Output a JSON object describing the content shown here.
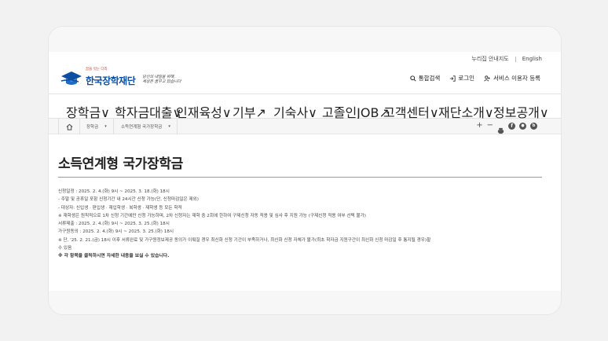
{
  "utility": {
    "sitemap": "누리집 안내지도",
    "english": "English"
  },
  "logo": {
    "small": "꿈을 잇는 다리",
    "name": "한국장학재단",
    "slogan_line1": "당신의 내일을 위해,",
    "slogan_line2": "세상은 꿈꾸고 있습니다"
  },
  "header_links": {
    "search": "통합검색",
    "login": "로그인",
    "signup": "서비스 이용자 등록"
  },
  "gnb": [
    {
      "label": "장학금",
      "mark": "∨"
    },
    {
      "label": "학자금대출",
      "mark": "∨"
    },
    {
      "label": "인재육성",
      "mark": "∨"
    },
    {
      "label": "기부",
      "mark": "↗"
    },
    {
      "label": "기숙사",
      "mark": "∨"
    },
    {
      "label": "고졸인JOB",
      "mark": "↗"
    },
    {
      "label": "고객센터",
      "mark": "∨"
    },
    {
      "label": "재단소개",
      "mark": "∨"
    },
    {
      "label": "정보공개",
      "mark": "∨"
    }
  ],
  "breadcrumb": {
    "level1": "장학금",
    "level2": "소득연계형 국가장학금"
  },
  "page_title": "소득연계형 국가장학금",
  "schedule": {
    "apply_label": "신청일정 :",
    "apply_value": "2025. 2. 4.(화) 9시 ~ 2025. 3. 18.(화) 18시",
    "apply_sub1": "- 주말 및 공휴일 포함 신청기간 내 24시간 신청 가능(단, 신청마감일은 제외)",
    "apply_sub2": "- 대상자: 신입생 · 편입생 · 재입학생 · 복학생 · 재학생 등 모든 학적",
    "apply_note": "※ 재학생은 원칙적으로 1차 신청 기간에만 신청 가능하며, 2차 신청자는 재학 중 2회에 한하여 구제신청 자동 적용 및 심사 후 지원 가능 (구제신청 적용 여부 선택 불가)",
    "docs_label": "서류제출 :",
    "docs_value": "2025. 2. 4.(화) 9시 ~ 2025. 3. 25.(화) 18시",
    "consent_label": "가구원동의 :",
    "consent_value": "2025. 2. 4.(화) 9시 ~ 2025. 3. 25.(화) 18시",
    "consent_note1": "※ 단, '25. 2. 21.(금) 18시 이후 서류완료 및 가구원정보제공 동의가 이뤄질 경우 최신화 신청 기간이 부족하거나, 최신화 신청 자체가 불가(최초 학자금 지원구간이 최신화 신청 마감일 후 통지될 경우)할",
    "consent_note2": "수 있음",
    "footer_note": "※ 각 항목을 클릭하시면 자세한 내용을 보실 수 있습니다."
  },
  "colors": {
    "brand_blue": "#0b4ea2",
    "accent_red": "#c0392b"
  }
}
